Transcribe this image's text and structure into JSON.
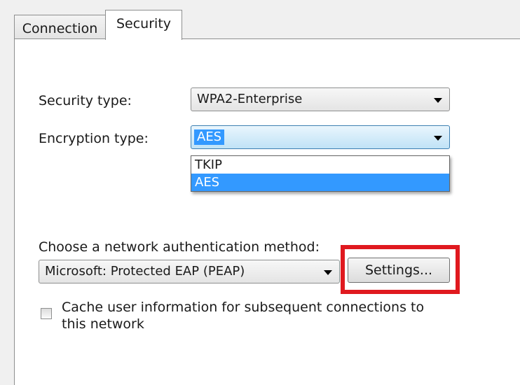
{
  "tabs": {
    "connection": "Connection",
    "security": "Security"
  },
  "security_type": {
    "label": "Security type:",
    "value": "WPA2-Enterprise"
  },
  "encryption_type": {
    "label": "Encryption type:",
    "value": "AES",
    "options": [
      "TKIP",
      "AES"
    ]
  },
  "auth": {
    "label": "Choose a network authentication method:",
    "method": "Microsoft: Protected EAP (PEAP)",
    "settings_label": "Settings..."
  },
  "cache": {
    "label": "Cache user information for subsequent connections to this network",
    "checked": false
  },
  "colors": {
    "highlight": "#e0191f",
    "selection": "#3399ff"
  },
  "icons": {
    "dropdown_arrow": "chevron-down-icon"
  }
}
